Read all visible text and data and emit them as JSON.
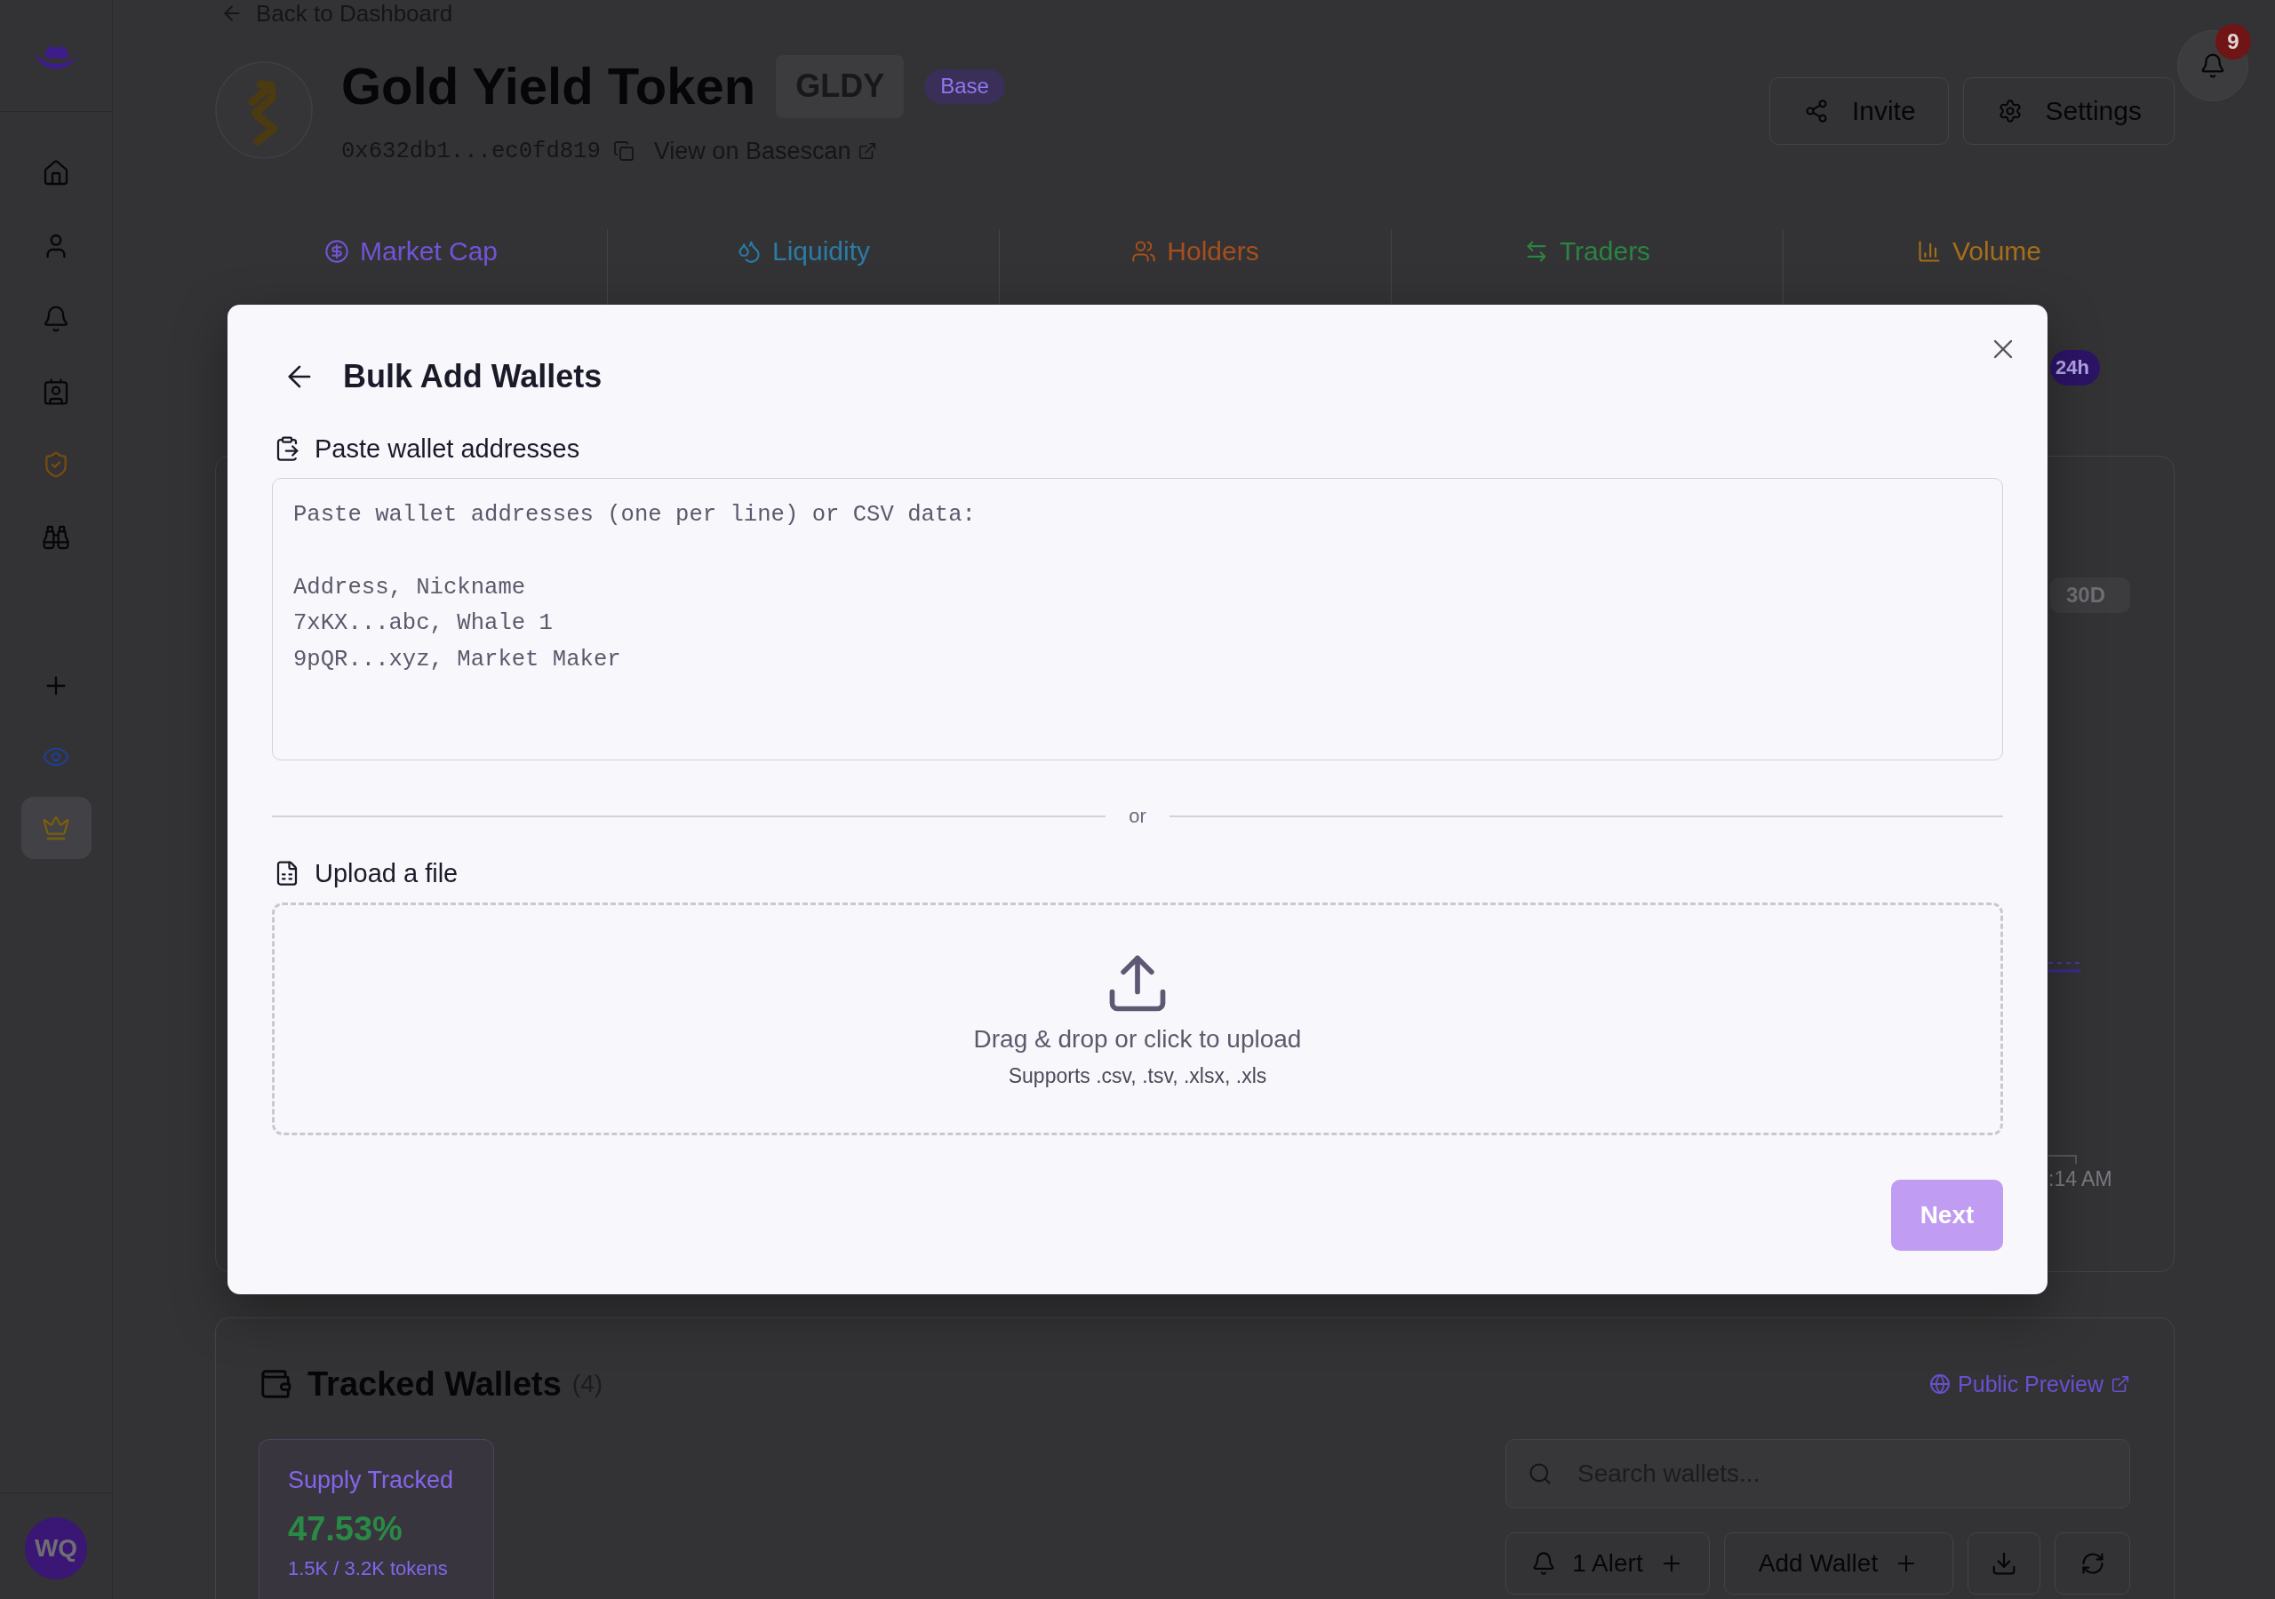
{
  "sidebar": {
    "nav_items": [
      {
        "selected": false
      },
      {
        "selected": false
      },
      {
        "selected": false
      },
      {
        "selected": false
      },
      {
        "selected": false
      },
      {
        "selected": false
      }
    ],
    "tool_items": [
      {
        "selected": false
      },
      {
        "selected": false
      },
      {
        "selected": true
      }
    ],
    "avatar": {
      "initials": "WQ"
    }
  },
  "notifications": {
    "count": "9"
  },
  "header": {
    "back_link": "Back to Dashboard",
    "title": "Gold Yield Token",
    "symbol": "GLDY",
    "chain": "Base",
    "address": "0x632db1...ec0fd819",
    "explorer_link": "View on Basescan",
    "actions": [
      {
        "kind": "share",
        "label": "Invite"
      },
      {
        "kind": "settings",
        "label": "Settings"
      }
    ]
  },
  "stats": [
    {
      "label": "Market Cap"
    },
    {
      "label": "Liquidity"
    },
    {
      "label": "Holders"
    },
    {
      "label": "Traders"
    },
    {
      "label": "Volume"
    }
  ],
  "period_toggle": [
    {
      "label": "24h",
      "selected": true
    }
  ],
  "chart": {
    "range_buttons": [
      {
        "label": "30D",
        "selected": false
      }
    ],
    "x_axis_label": ":14 AM"
  },
  "tracked_wallets": {
    "title": "Tracked Wallets",
    "count": "(4)",
    "public_preview": "Public Preview",
    "supply": {
      "label": "Supply Tracked",
      "value": "47.53%",
      "detail": "1.5K / 3.2K tokens"
    },
    "search": {
      "placeholder": "Search wallets..."
    },
    "actions": [
      {
        "kind": "alert",
        "label": "1 Alert"
      },
      {
        "kind": "add",
        "label": "Add Wallet"
      },
      {
        "kind": "download"
      },
      {
        "kind": "refresh"
      }
    ]
  },
  "modal": {
    "title": "Bulk Add Wallets",
    "paste": {
      "label": "Paste wallet addresses",
      "placeholder": "Paste wallet addresses (one per line) or CSV data:\n\nAddress, Nickname\n7xKX...abc, Whale 1\n9pQR...xyz, Market Maker"
    },
    "divider": "or",
    "upload": {
      "label": "Upload a file",
      "prompt": "Drag & drop or click to upload",
      "formats": "Supports .csv, .tsv, .xlsx, .xls"
    },
    "next": {
      "label": "Next",
      "disabled": true
    }
  }
}
